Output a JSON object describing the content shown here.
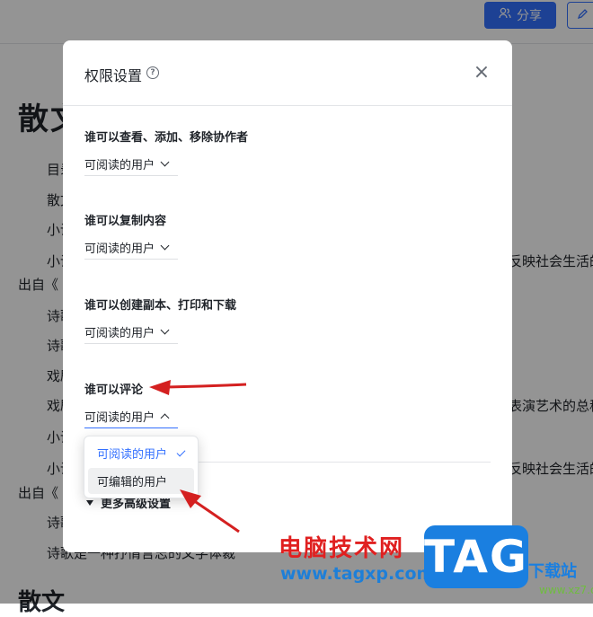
{
  "topbar": {
    "share_label": "分享",
    "edit_icon": "pencil-icon"
  },
  "document": {
    "title": "散文",
    "title2": "散文",
    "lines": [
      "目录",
      "散文",
      "小说",
      "小说",
      "出自《",
      "诗歌",
      "诗歌",
      "戏剧",
      "戏剧",
      "小说",
      "小说",
      "出自《",
      "诗歌",
      "诗歌是一种抒情言志的文学体裁"
    ],
    "right_fragments": [
      "反映社会生活的",
      "表演艺术的总称",
      "反映社会生活的"
    ]
  },
  "dialog": {
    "title": "权限设置",
    "help_icon": "?",
    "close_icon": "×",
    "sections": [
      {
        "label": "谁可以查看、添加、移除协作者",
        "value": "可阅读的用户"
      },
      {
        "label": "谁可以复制内容",
        "value": "可阅读的用户"
      },
      {
        "label": "谁可以创建副本、打印和下载",
        "value": "可阅读的用户"
      },
      {
        "label": "谁可以评论",
        "value": "可阅读的用户"
      }
    ],
    "more_settings": "更多高级设置",
    "dropdown_options": [
      {
        "label": "可阅读的用户",
        "selected": true
      },
      {
        "label": "可编辑的用户",
        "selected": false
      }
    ]
  },
  "watermark": {
    "site_name": "电脑技术网",
    "url": "www.tagxp.com",
    "logo": "TAG",
    "side": "下载站",
    "side2": "www.xz7.com"
  },
  "colors": {
    "accent": "#3370ff",
    "annotation": "#d42020"
  }
}
